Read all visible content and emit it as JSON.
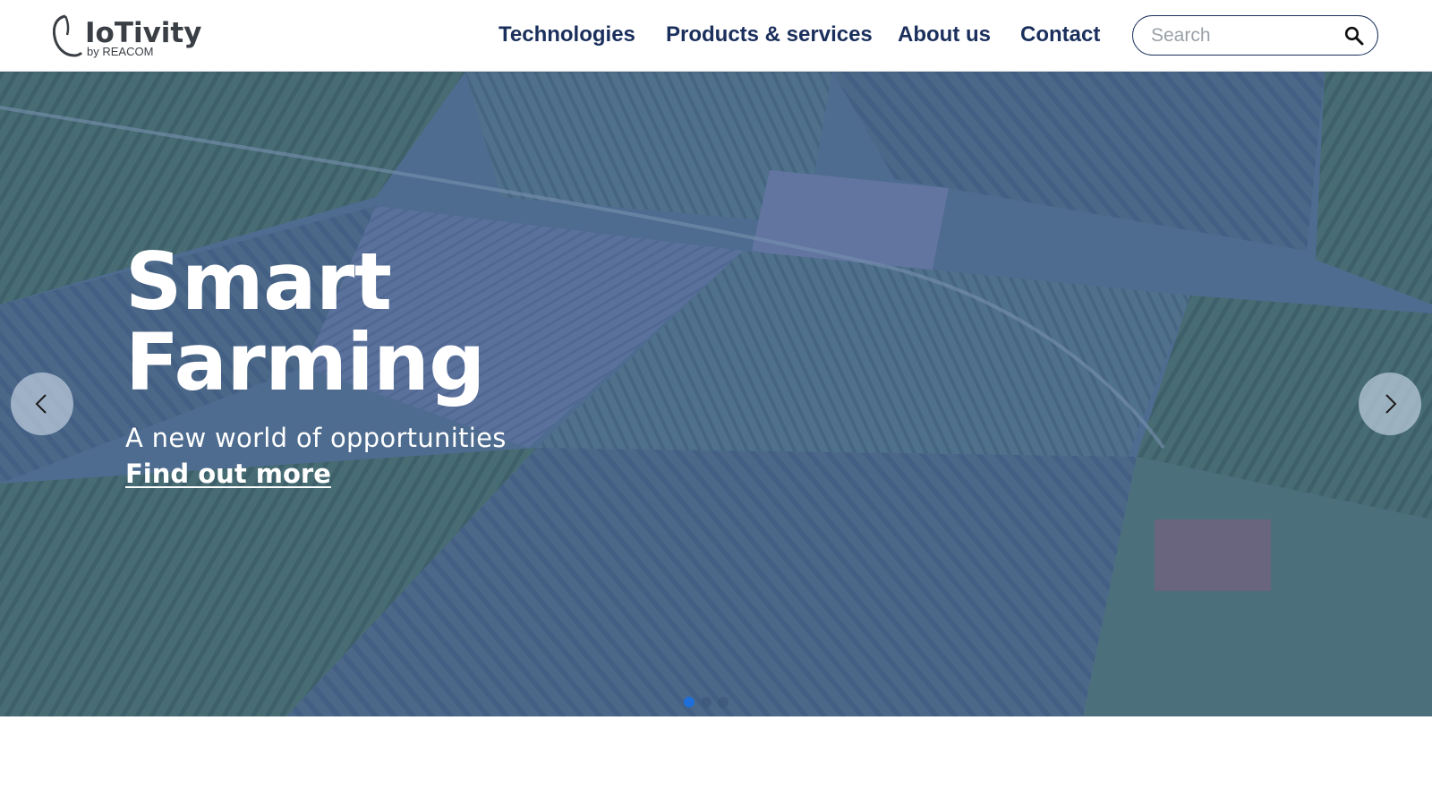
{
  "brand": {
    "logo_name": "IoTivity",
    "logo_byline": "by REACOM"
  },
  "nav": {
    "items": [
      {
        "label": "Technologies"
      },
      {
        "label": "Products & services"
      },
      {
        "label": "About us"
      },
      {
        "label": "Contact"
      }
    ]
  },
  "search": {
    "placeholder": "Search",
    "value": "",
    "icon": "search-icon"
  },
  "hero": {
    "title_line1": "Smart",
    "title_line2": "Farming",
    "subtitle": "A new world of opportunities",
    "link_label": "Find out more",
    "prev_icon": "chevron-left-icon",
    "next_icon": "chevron-right-icon",
    "slide_count": 3,
    "active_slide": 1
  },
  "colors": {
    "nav_text": "#1a2f5c",
    "overlay": "#3d5f8f",
    "active_dot": "#1e6fd9"
  }
}
